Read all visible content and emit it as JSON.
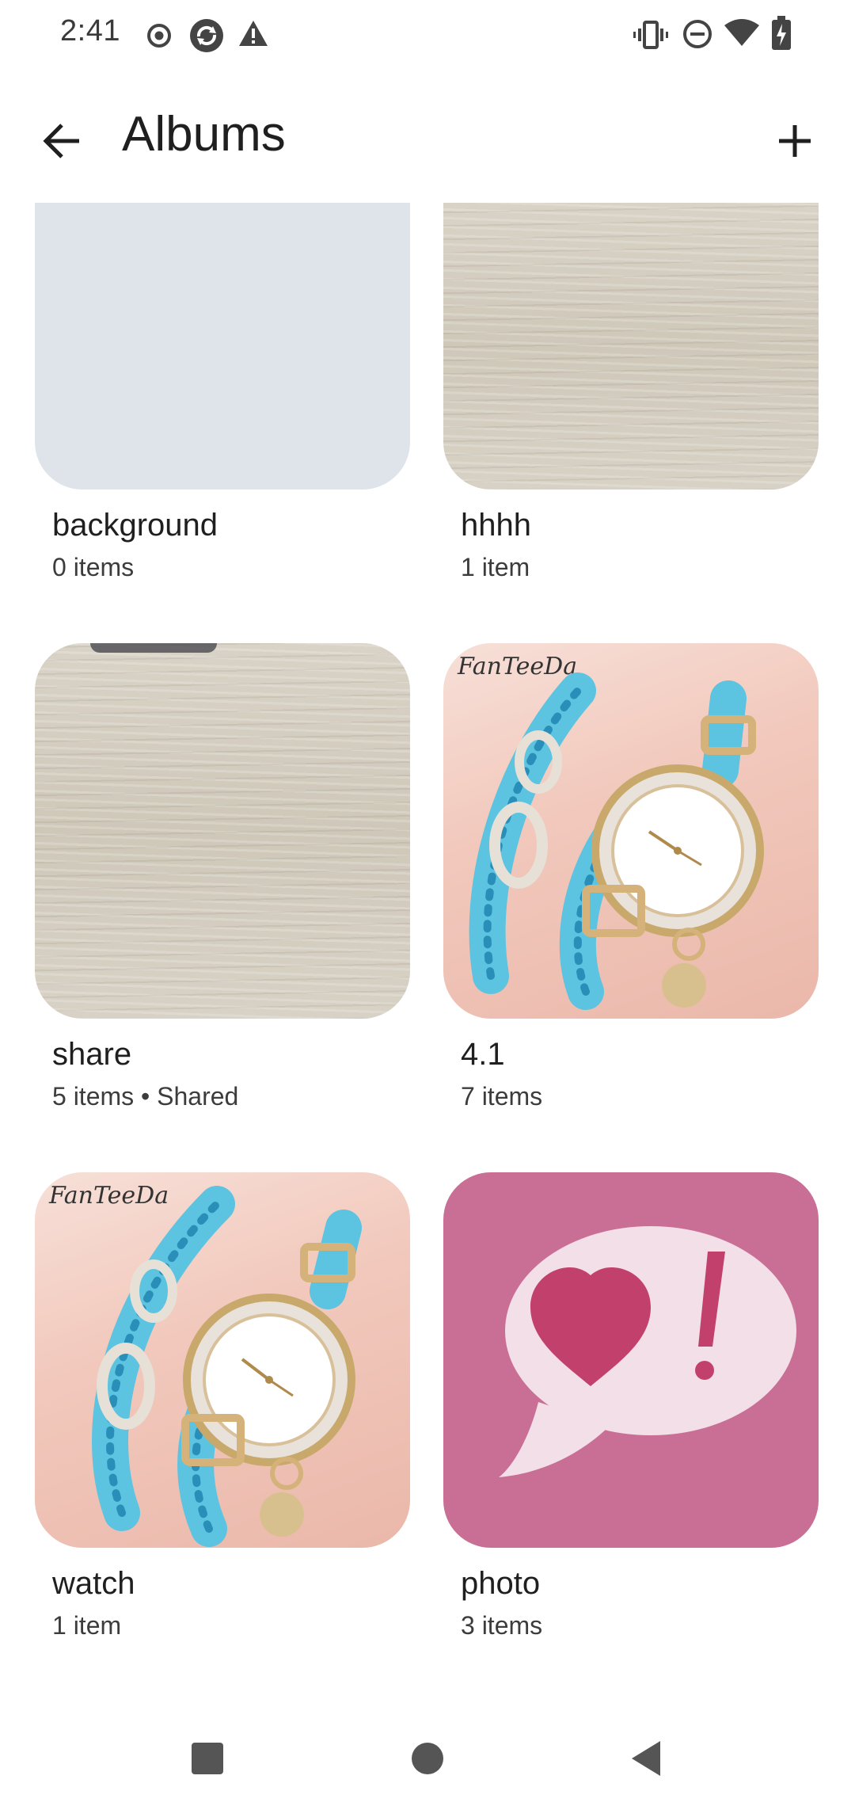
{
  "status_bar": {
    "time": "2:41"
  },
  "app_bar": {
    "title": "Albums",
    "back_icon": "arrow-back-icon",
    "add_icon": "add-icon"
  },
  "albums": [
    {
      "name": "background",
      "meta": "0 items",
      "thumb": "empty"
    },
    {
      "name": "hhhh",
      "meta": "1 item",
      "thumb": "wood"
    },
    {
      "name": "share",
      "meta": "5 items • Shared",
      "thumb": "wood"
    },
    {
      "name": "4.1",
      "meta": "7 items",
      "thumb": "watch",
      "thumb_text": "FanTeeDa"
    },
    {
      "name": "watch",
      "meta": "1 item",
      "thumb": "watch",
      "thumb_text": "FanTeeDa"
    },
    {
      "name": "photo",
      "meta": "3 items",
      "thumb": "heart-speech-bubble"
    }
  ],
  "nav_bar": {
    "recents_icon": "square-icon",
    "home_icon": "circle-icon",
    "back_icon": "triangle-back-icon"
  },
  "colors": {
    "empty_thumb": "#dfe3ea",
    "photo_thumb": "#c96f96",
    "heart": "#c2406c",
    "bubble": "#f3dfe7"
  }
}
